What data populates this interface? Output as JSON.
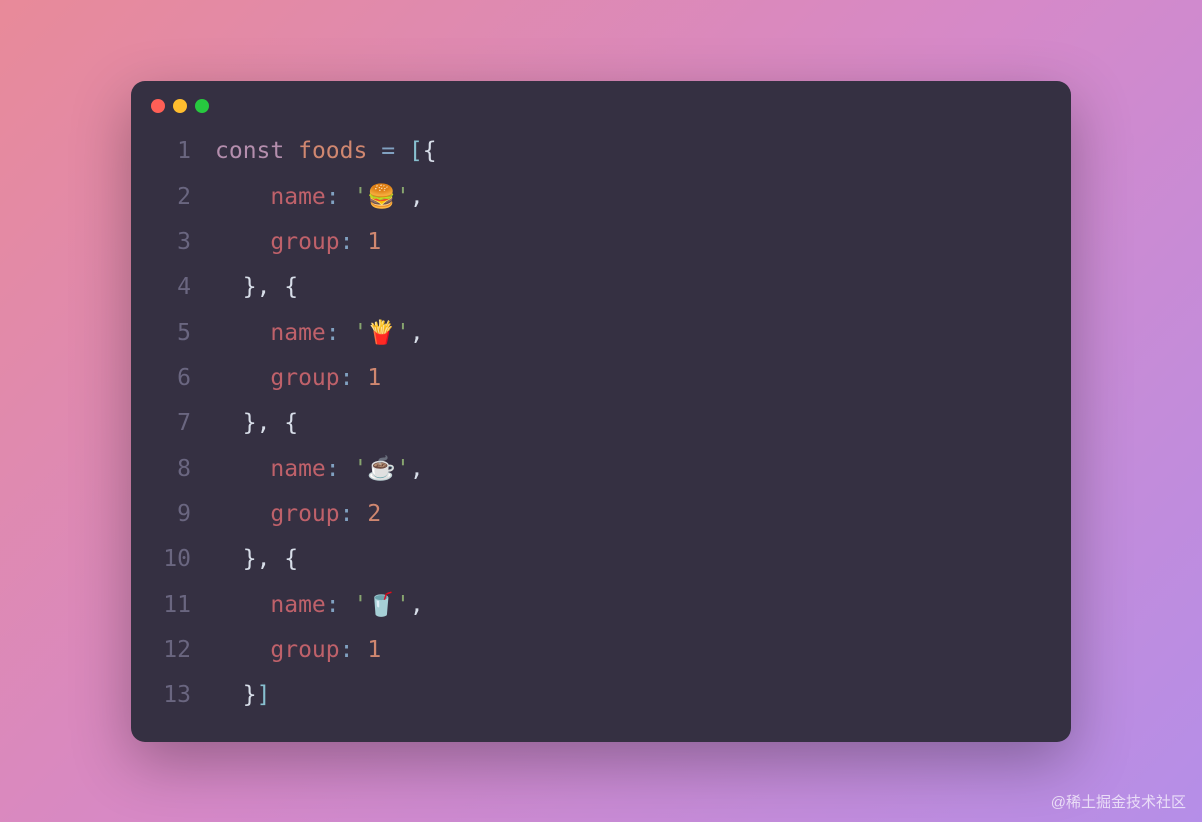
{
  "editor": {
    "lines": [
      {
        "num": "1",
        "indent": "",
        "tokens": [
          {
            "t": "const ",
            "c": "tok-keyword"
          },
          {
            "t": "foods ",
            "c": "tok-var"
          },
          {
            "t": "= ",
            "c": "tok-op"
          },
          {
            "t": "[",
            "c": "tok-punct"
          },
          {
            "t": "{",
            "c": "tok-punct2"
          }
        ]
      },
      {
        "num": "2",
        "indent": "    ",
        "tokens": [
          {
            "t": "name",
            "c": "tok-prop"
          },
          {
            "t": ": ",
            "c": "tok-colon"
          },
          {
            "t": "'",
            "c": "tok-quote"
          },
          {
            "t": "🍔",
            "c": "tok-string tok-emoji"
          },
          {
            "t": "'",
            "c": "tok-quote"
          },
          {
            "t": ",",
            "c": "tok-punct2"
          }
        ]
      },
      {
        "num": "3",
        "indent": "    ",
        "tokens": [
          {
            "t": "group",
            "c": "tok-prop"
          },
          {
            "t": ": ",
            "c": "tok-colon"
          },
          {
            "t": "1",
            "c": "tok-number"
          }
        ]
      },
      {
        "num": "4",
        "indent": "  ",
        "tokens": [
          {
            "t": "}",
            "c": "tok-punct2"
          },
          {
            "t": ", ",
            "c": "tok-punct2"
          },
          {
            "t": "{",
            "c": "tok-punct2"
          }
        ]
      },
      {
        "num": "5",
        "indent": "    ",
        "tokens": [
          {
            "t": "name",
            "c": "tok-prop"
          },
          {
            "t": ": ",
            "c": "tok-colon"
          },
          {
            "t": "'",
            "c": "tok-quote"
          },
          {
            "t": "🍟",
            "c": "tok-string tok-emoji"
          },
          {
            "t": "'",
            "c": "tok-quote"
          },
          {
            "t": ",",
            "c": "tok-punct2"
          }
        ]
      },
      {
        "num": "6",
        "indent": "    ",
        "tokens": [
          {
            "t": "group",
            "c": "tok-prop"
          },
          {
            "t": ": ",
            "c": "tok-colon"
          },
          {
            "t": "1",
            "c": "tok-number"
          }
        ]
      },
      {
        "num": "7",
        "indent": "  ",
        "tokens": [
          {
            "t": "}",
            "c": "tok-punct2"
          },
          {
            "t": ", ",
            "c": "tok-punct2"
          },
          {
            "t": "{",
            "c": "tok-punct2"
          }
        ]
      },
      {
        "num": "8",
        "indent": "    ",
        "tokens": [
          {
            "t": "name",
            "c": "tok-prop"
          },
          {
            "t": ": ",
            "c": "tok-colon"
          },
          {
            "t": "'",
            "c": "tok-quote"
          },
          {
            "t": "☕",
            "c": "tok-string tok-emoji"
          },
          {
            "t": "'",
            "c": "tok-quote"
          },
          {
            "t": ",",
            "c": "tok-punct2"
          }
        ]
      },
      {
        "num": "9",
        "indent": "    ",
        "tokens": [
          {
            "t": "group",
            "c": "tok-prop"
          },
          {
            "t": ": ",
            "c": "tok-colon"
          },
          {
            "t": "2",
            "c": "tok-number"
          }
        ]
      },
      {
        "num": "10",
        "indent": "  ",
        "tokens": [
          {
            "t": "}",
            "c": "tok-punct2"
          },
          {
            "t": ", ",
            "c": "tok-punct2"
          },
          {
            "t": "{",
            "c": "tok-punct2"
          }
        ]
      },
      {
        "num": "11",
        "indent": "    ",
        "tokens": [
          {
            "t": "name",
            "c": "tok-prop"
          },
          {
            "t": ": ",
            "c": "tok-colon"
          },
          {
            "t": "'",
            "c": "tok-quote"
          },
          {
            "t": "🥤",
            "c": "tok-string tok-emoji"
          },
          {
            "t": "'",
            "c": "tok-quote"
          },
          {
            "t": ",",
            "c": "tok-punct2"
          }
        ]
      },
      {
        "num": "12",
        "indent": "    ",
        "tokens": [
          {
            "t": "group",
            "c": "tok-prop"
          },
          {
            "t": ": ",
            "c": "tok-colon"
          },
          {
            "t": "1",
            "c": "tok-number"
          }
        ]
      },
      {
        "num": "13",
        "indent": "  ",
        "tokens": [
          {
            "t": "}",
            "c": "tok-punct2"
          },
          {
            "t": "]",
            "c": "tok-punct"
          }
        ]
      }
    ]
  },
  "watermark": "@稀土掘金技术社区"
}
